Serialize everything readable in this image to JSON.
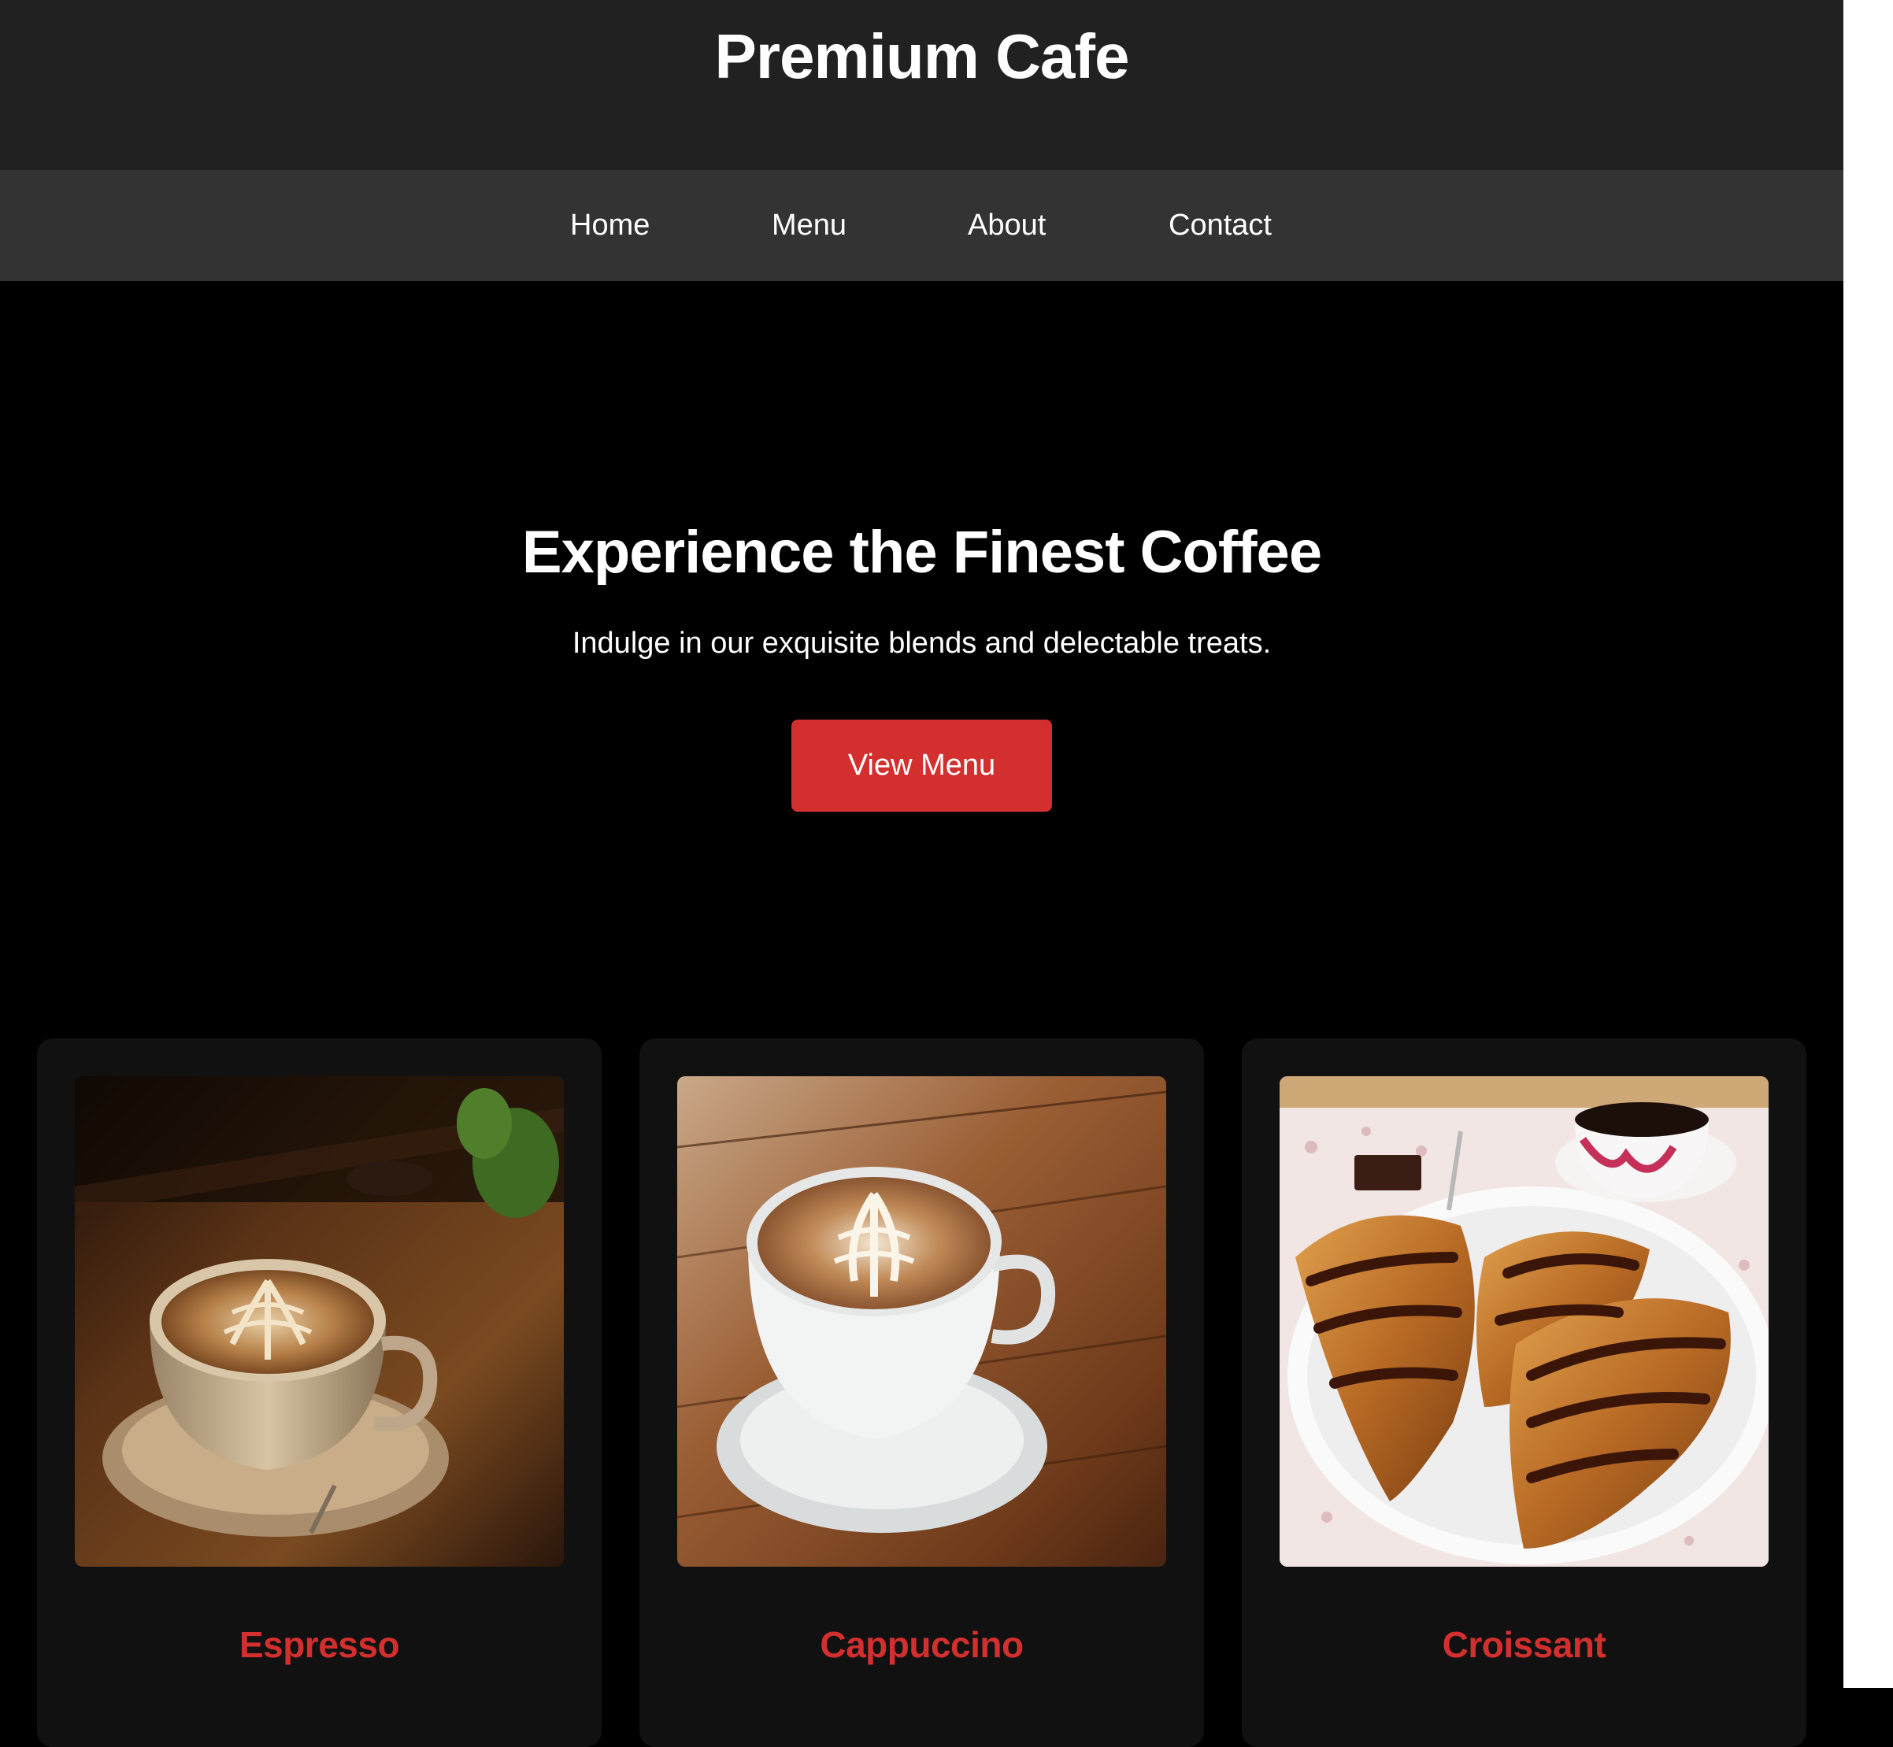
{
  "header": {
    "title": "Premium Cafe"
  },
  "nav": {
    "items": [
      {
        "label": "Home"
      },
      {
        "label": "Menu"
      },
      {
        "label": "About"
      },
      {
        "label": "Contact"
      }
    ]
  },
  "hero": {
    "title": "Experience the Finest Coffee",
    "subtitle": "Indulge in our exquisite blends and delectable treats.",
    "cta_label": "View Menu"
  },
  "menu_cards": [
    {
      "name": "Espresso"
    },
    {
      "name": "Cappuccino"
    },
    {
      "name": "Croissant"
    }
  ],
  "colors": {
    "header_bg": "#212121",
    "nav_bg": "#333333",
    "page_bg": "#000000",
    "card_bg": "#111111",
    "accent": "#d32f2f"
  }
}
